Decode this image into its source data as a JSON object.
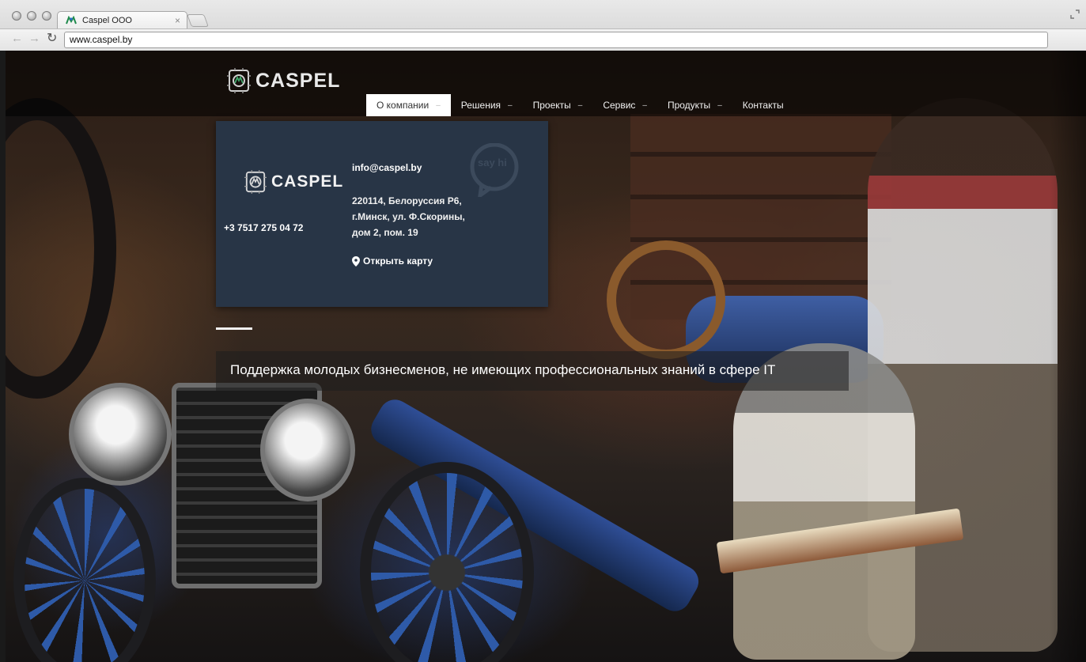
{
  "browser": {
    "tab_title": "Caspel OOO",
    "tab_close": "×",
    "url": "www.caspel.by",
    "back": "←",
    "forward": "→",
    "reload": "↻"
  },
  "site": {
    "logo_text": "CASPEL",
    "nav": [
      {
        "label": "О компании",
        "active": true
      },
      {
        "label": "Решения"
      },
      {
        "label": "Проекты"
      },
      {
        "label": "Сервис"
      },
      {
        "label": "Продукты"
      },
      {
        "label": "Контакты"
      }
    ],
    "chevron": "–"
  },
  "contact_panel": {
    "logo_text": "CASPEL",
    "phone": "+3 7517 275 04 72",
    "email": "info@caspel.by",
    "address_lines": [
      "220114, Белоруссия Р6,",
      "г.Минск, ул. Ф.Скорины,",
      "дом 2, пом. 19"
    ],
    "map_link": "Открыть карту",
    "say_hi": "say hi"
  },
  "slider": {
    "caption": "Поддержка молодых бизнесменов, не имеющих профессиональных знаний в сфере IT"
  },
  "colors": {
    "panel_bg": "#283546",
    "nav_active_bg": "#ffffff",
    "text_light": "#ffffff"
  }
}
